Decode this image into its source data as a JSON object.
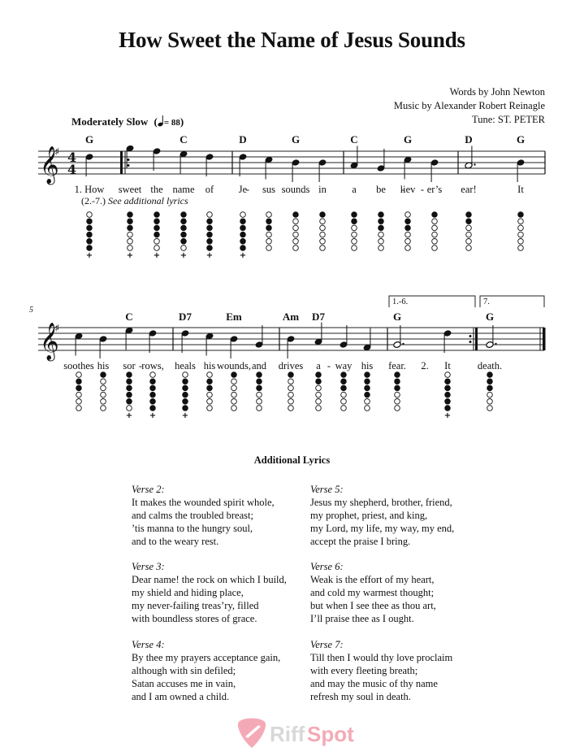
{
  "title": "How Sweet the Name of Jesus Sounds",
  "credits": {
    "words": "Words by John Newton",
    "music": "Music by Alexander Robert Reinagle",
    "tune": "Tune: ST. PETER"
  },
  "tempo": {
    "label": "Moderately Slow",
    "bpm_text": "= 88",
    "open_paren": "(",
    "close_paren": ")"
  },
  "key_signature": "G major (1 sharp)",
  "time_signature": {
    "top": "4",
    "bottom": "4"
  },
  "systems": [
    {
      "measure_number": "",
      "chords": [
        {
          "label": "G",
          "note": 0
        },
        {
          "label": "C",
          "note": 3
        },
        {
          "label": "D",
          "note": 5
        },
        {
          "label": "G",
          "note": 7
        },
        {
          "label": "C",
          "note": 9
        },
        {
          "label": "G",
          "note": 11
        },
        {
          "label": "D",
          "note": 13
        },
        {
          "label": "G",
          "note": 14
        }
      ],
      "notes": [
        {
          "pitch": "D5",
          "dur": "q",
          "lyric": "1. How",
          "holes": [
            0,
            1,
            1,
            1,
            1,
            1
          ],
          "plus": true
        },
        {
          "pitch": "G5",
          "dur": "q",
          "lyric": "sweet",
          "holes": [
            1,
            1,
            1,
            0,
            0,
            0
          ],
          "plus": true
        },
        {
          "pitch": "F#5",
          "dur": "q",
          "lyric": "the",
          "holes": [
            1,
            1,
            1,
            1,
            0,
            0
          ],
          "plus": true
        },
        {
          "pitch": "E5",
          "dur": "q",
          "lyric": "name",
          "holes": [
            1,
            1,
            1,
            1,
            1,
            0
          ],
          "plus": true
        },
        {
          "pitch": "D5",
          "dur": "q",
          "lyric": "of",
          "holes": [
            0,
            1,
            1,
            1,
            1,
            1
          ],
          "plus": true
        },
        {
          "pitch": "D5",
          "dur": "q",
          "lyric": "Je",
          "holes": [
            0,
            1,
            1,
            1,
            1,
            1
          ],
          "plus": true
        },
        {
          "pitch": "C5",
          "dur": "q",
          "lyric": "-",
          "holes": [
            0,
            1,
            1,
            0,
            0,
            0
          ],
          "plus": false,
          "lyric_is_hyphen_then": "sus"
        },
        {
          "pitch": "B4",
          "dur": "q",
          "lyric": "sounds",
          "holes": [
            1,
            0,
            0,
            0,
            0,
            0
          ],
          "plus": false
        },
        {
          "pitch": "B4",
          "dur": "q",
          "lyric": "in",
          "holes": [
            1,
            0,
            0,
            0,
            0,
            0
          ],
          "plus": false
        },
        {
          "pitch": "A4",
          "dur": "q",
          "lyric": "a",
          "holes": [
            1,
            1,
            0,
            0,
            0,
            0
          ],
          "plus": false
        },
        {
          "pitch": "G4",
          "dur": "q",
          "lyric": "be",
          "holes": [
            1,
            1,
            1,
            0,
            0,
            0
          ],
          "plus": false
        },
        {
          "pitch": "C5",
          "dur": "q",
          "lyric": "liev",
          "holes": [
            0,
            1,
            1,
            0,
            0,
            0
          ],
          "plus": false
        },
        {
          "pitch": "B4",
          "dur": "q",
          "lyric": "er’s",
          "holes": [
            1,
            0,
            0,
            0,
            0,
            0
          ],
          "plus": false
        },
        {
          "pitch": "A4",
          "dur": "h.",
          "lyric": "ear!",
          "holes": [
            1,
            1,
            0,
            0,
            0,
            0
          ],
          "plus": false
        },
        {
          "pitch": "B4",
          "dur": "q",
          "lyric": "It",
          "holes": [
            1,
            0,
            0,
            0,
            0,
            0
          ],
          "plus": false
        }
      ],
      "verse_note": {
        "range": "(2.-7.)",
        "text": "See additional lyrics"
      }
    },
    {
      "measure_number": "5",
      "chords": [
        {
          "label": "C",
          "note": 2
        },
        {
          "label": "D7",
          "note": 4
        },
        {
          "label": "Em",
          "note": 6
        },
        {
          "label": "Am",
          "note": 8
        },
        {
          "label": "D7",
          "note": 9
        },
        {
          "label": "G",
          "note": 12
        },
        {
          "label": "G",
          "note": 14
        }
      ],
      "notes": [
        {
          "pitch": "C5",
          "dur": "q",
          "lyric": "soothes",
          "holes": [
            0,
            1,
            1,
            0,
            0,
            0
          ],
          "plus": false
        },
        {
          "pitch": "B4",
          "dur": "q",
          "lyric": "his",
          "holes": [
            1,
            0,
            0,
            0,
            0,
            0
          ],
          "plus": false
        },
        {
          "pitch": "E5",
          "dur": "q",
          "lyric": "sor",
          "holes": [
            1,
            1,
            1,
            1,
            1,
            0
          ],
          "plus": true
        },
        {
          "pitch": "D5",
          "dur": "q",
          "lyric": "rows,",
          "holes": [
            0,
            1,
            1,
            1,
            1,
            1
          ],
          "plus": true
        },
        {
          "pitch": "D5",
          "dur": "q",
          "lyric": "heals",
          "holes": [
            0,
            1,
            1,
            1,
            1,
            1
          ],
          "plus": true
        },
        {
          "pitch": "C5",
          "dur": "q",
          "lyric": "his",
          "holes": [
            0,
            1,
            1,
            0,
            0,
            0
          ],
          "plus": false
        },
        {
          "pitch": "B4",
          "dur": "q",
          "lyric": "wounds,",
          "holes": [
            1,
            0,
            0,
            0,
            0,
            0
          ],
          "plus": false
        },
        {
          "pitch": "G4",
          "dur": "q",
          "lyric": "and",
          "holes": [
            1,
            1,
            1,
            0,
            0,
            0
          ],
          "plus": false
        },
        {
          "pitch": "B4",
          "dur": "q",
          "lyric": "drives",
          "holes": [
            1,
            0,
            0,
            0,
            0,
            0
          ],
          "plus": false
        },
        {
          "pitch": "A4",
          "dur": "q",
          "lyric": "a",
          "holes": [
            1,
            1,
            0,
            0,
            0,
            0
          ],
          "plus": false
        },
        {
          "pitch": "G4",
          "dur": "q",
          "lyric": "way",
          "holes": [
            1,
            1,
            1,
            0,
            0,
            0
          ],
          "plus": false
        },
        {
          "pitch": "F#4",
          "dur": "q",
          "lyric": "his",
          "holes": [
            1,
            1,
            1,
            1,
            0,
            0
          ],
          "plus": false
        },
        {
          "pitch": "G4",
          "dur": "h.",
          "lyric": "fear.",
          "holes": [
            1,
            1,
            1,
            0,
            0,
            0
          ],
          "plus": false
        },
        {
          "pitch": "D5",
          "dur": "q",
          "lyric": "It",
          "holes": [
            0,
            1,
            1,
            1,
            1,
            1
          ],
          "plus": true
        },
        {
          "pitch": "G4",
          "dur": "h.",
          "lyric": "death.",
          "holes": [
            1,
            1,
            1,
            0,
            0,
            0
          ],
          "plus": false
        }
      ],
      "extra_lyric": "2.",
      "voltas": [
        "1.-6.",
        "7."
      ]
    }
  ],
  "additional_lyrics": {
    "heading": "Additional Lyrics",
    "verses": [
      {
        "label": "Verse 2:",
        "lines": [
          "It makes the wounded spirit whole,",
          "and calms the troubled breast;",
          "’tis manna to the hungry soul,",
          "and to the weary rest."
        ]
      },
      {
        "label": "Verse 3:",
        "lines": [
          "Dear name! the rock on which I build,",
          "my shield and hiding place,",
          "my never-failing treas’ry, filled",
          "with boundless stores of grace."
        ]
      },
      {
        "label": "Verse 4:",
        "lines": [
          "By thee my prayers acceptance gain,",
          "although with sin defiled;",
          "Satan accuses me in vain,",
          "and I am owned a child."
        ]
      },
      {
        "label": "Verse 5:",
        "lines": [
          "Jesus my shepherd, brother, friend,",
          "my prophet, priest, and king,",
          "my Lord, my life, my way, my end,",
          "accept the praise I bring."
        ]
      },
      {
        "label": "Verse 6:",
        "lines": [
          "Weak is the effort of my heart,",
          "and cold my warmest thought;",
          "but when I see thee as thou art,",
          "I’ll praise thee as I ought."
        ]
      },
      {
        "label": "Verse 7:",
        "lines": [
          "Till then I would thy love proclaim",
          "with every fleeting breath;",
          "and may the music of thy name",
          "refresh my soul in death."
        ]
      }
    ]
  },
  "logo": {
    "text_a": "Riff",
    "text_b": "Spot",
    "color": "#f4aab6"
  }
}
